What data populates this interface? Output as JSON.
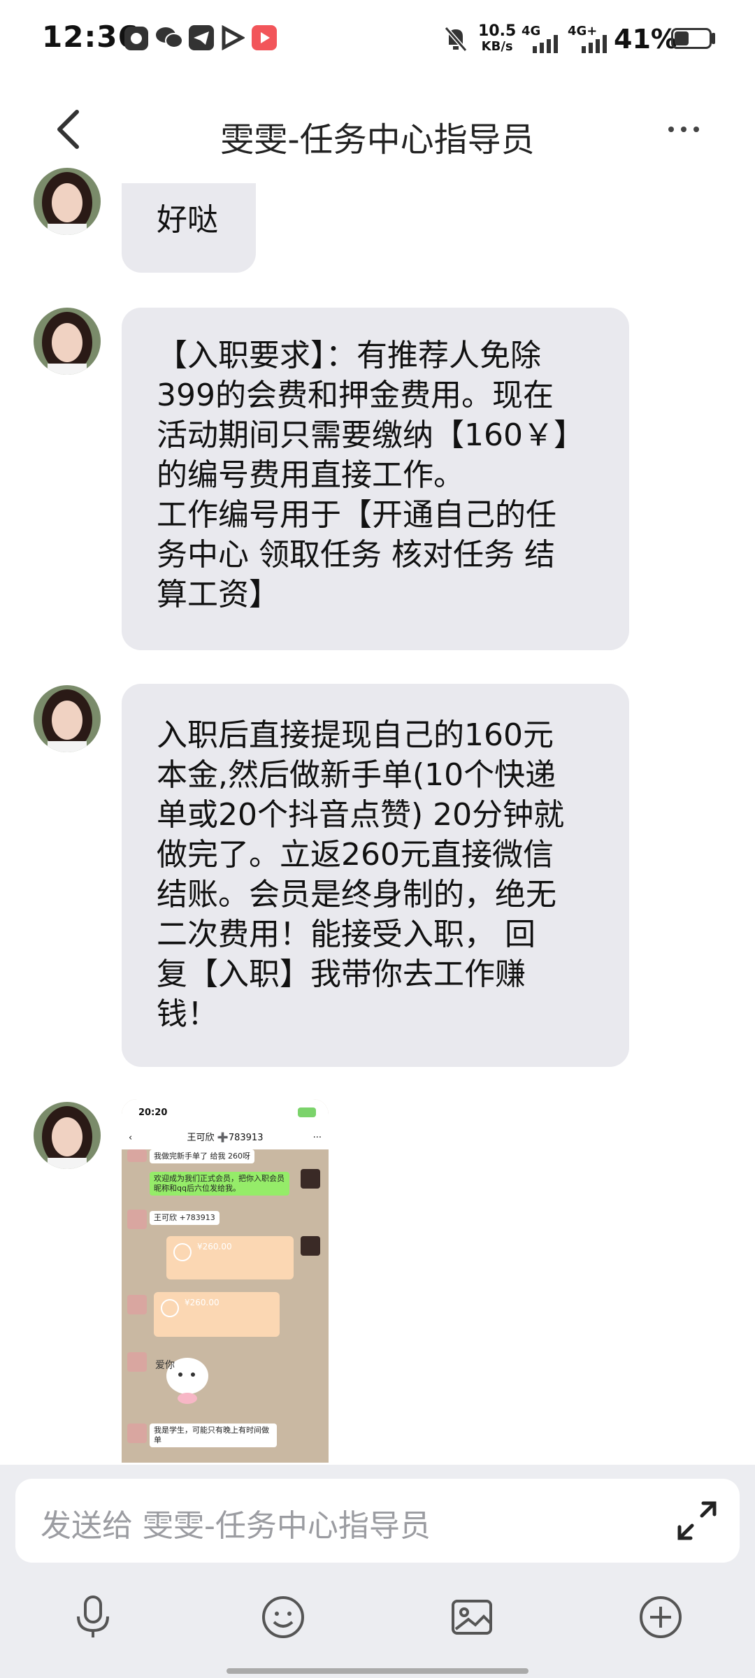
{
  "status": {
    "time": "12:36",
    "net_speed_value": "10.5",
    "net_speed_unit": "KB/s",
    "network1": "4G",
    "network2": "4G+",
    "battery": "41%"
  },
  "header": {
    "title": "雯雯-任务中心指导员"
  },
  "messages": [
    {
      "text": "好哒"
    },
    {
      "text": "【入职要求】：有推荐人免除\n399的会费和押金费用。现在\n活动期间只需要缴纳【160￥】\n的编号费用直接工作。\n工作编号用于【开通自己的任\n务中心 领取任务 核对任务 结\n算工资】"
    },
    {
      "text": "入职后直接提现自己的160元\n本金,然后做新手单(10个快递\n单或20个抖音点赞) 20分钟就\n做完了。立返260元直接微信\n结账。会员是终身制的，绝无\n二次费用！能接受入职， 回\n复【入职】我带你去工作赚\n钱！"
    }
  ],
  "shared_image": {
    "time": "20:20",
    "title": "王可欣 ➕783913",
    "line1": "我做完新手单了 给我 260呀",
    "line2": "欢迎成为我们正式会员，把你入职会员昵称和qq后六位发给我。",
    "line3": "王可欣 +783913",
    "amount1": "¥260.00",
    "amount2": "¥260.00",
    "sticker": "爱你",
    "line4": "我是学生，可能只有晚上有时间做单"
  },
  "input": {
    "placeholder": "发送给 雯雯-任务中心指导员"
  },
  "colors": {
    "bubble": "#e9e9ee",
    "input_bar": "#ecedf1"
  }
}
